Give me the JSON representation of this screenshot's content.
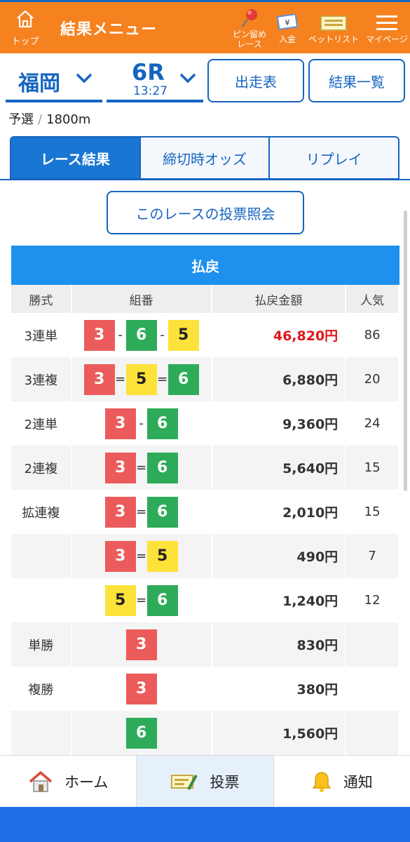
{
  "header": {
    "home_label": "トップ",
    "title": "結果メニュー",
    "pin_label_1": "ピン留め",
    "pin_label_2": "レース",
    "deposit_label": "入金",
    "betlist_label": "ベットリスト",
    "mypage_label": "マイページ",
    "bg_color": "#f5821f"
  },
  "selectors": {
    "venue": "福岡",
    "race": "6R",
    "time": "13:27",
    "entries_button": "出走表",
    "results_button": "結果一覧"
  },
  "race_info": {
    "grade": "予選",
    "distance": "1800m"
  },
  "tabs": [
    {
      "label": "レース結果",
      "active": true
    },
    {
      "label": "締切時オッズ",
      "active": false
    },
    {
      "label": "リプレイ",
      "active": false
    }
  ],
  "vote_button": "このレースの投票照会",
  "payout": {
    "title": "払戻",
    "columns": [
      "勝式",
      "組番",
      "払戻金額",
      "人気"
    ],
    "rows": [
      {
        "kind": "3連単",
        "boats": [
          "3",
          "6",
          "5"
        ],
        "sep": "-",
        "amount": "46,820円",
        "popularity": "86"
      },
      {
        "kind": "3連複",
        "boats": [
          "3",
          "5",
          "6"
        ],
        "sep": "=",
        "amount": "6,880円",
        "popularity": "20"
      },
      {
        "kind": "2連単",
        "boats": [
          "3",
          "6"
        ],
        "sep": "-",
        "amount": "9,360円",
        "popularity": "24"
      },
      {
        "kind": "2連複",
        "boats": [
          "3",
          "6"
        ],
        "sep": "=",
        "amount": "5,640円",
        "popularity": "15"
      },
      {
        "kind": "拡連複",
        "boats": [
          "3",
          "6"
        ],
        "sep": "=",
        "amount": "2,010円",
        "popularity": "15"
      },
      {
        "kind": "",
        "boats": [
          "3",
          "5"
        ],
        "sep": "=",
        "amount": "490円",
        "popularity": "7"
      },
      {
        "kind": "",
        "boats": [
          "5",
          "6"
        ],
        "sep": "=",
        "amount": "1,240円",
        "popularity": "12"
      },
      {
        "kind": "単勝",
        "boats": [
          "3"
        ],
        "sep": "",
        "amount": "830円",
        "popularity": ""
      },
      {
        "kind": "複勝",
        "boats": [
          "3"
        ],
        "sep": "",
        "amount": "380円",
        "popularity": ""
      },
      {
        "kind": "",
        "boats": [
          "6"
        ],
        "sep": "",
        "amount": "1,560円",
        "popularity": ""
      }
    ]
  },
  "boat_colors": {
    "3": "#ec5b5b",
    "5": "#fde23a",
    "6": "#2eab59"
  },
  "bottom_nav": {
    "home": "ホーム",
    "vote": "投票",
    "notify": "通知"
  }
}
